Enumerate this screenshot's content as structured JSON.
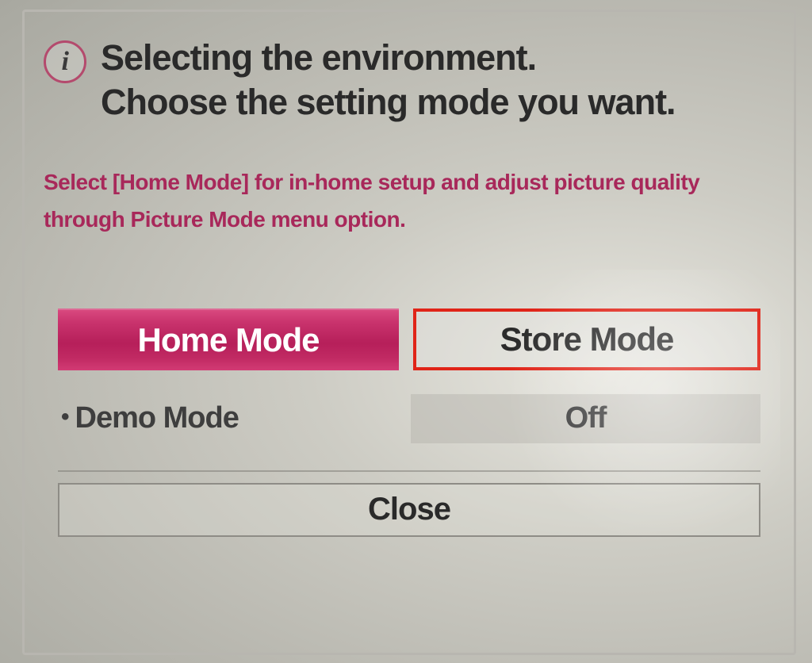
{
  "header": {
    "icon_glyph": "i",
    "title_line_1": "Selecting the environment.",
    "title_line_2": "Choose the setting mode you want."
  },
  "description": "Select [Home Mode] for in-home setup and adjust picture quality through Picture Mode menu option.",
  "modes": {
    "home": "Home Mode",
    "store": "Store Mode"
  },
  "demo": {
    "label": "Demo Mode",
    "value": "Off"
  },
  "actions": {
    "close": "Close"
  },
  "colors": {
    "accent": "#b61f5a",
    "highlight_border": "#e02418"
  }
}
